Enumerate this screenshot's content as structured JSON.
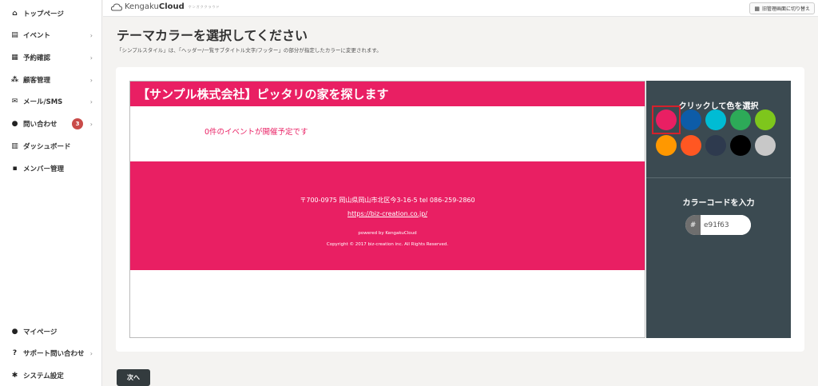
{
  "sidebar": {
    "top_items": [
      {
        "label": "トップページ",
        "icon": "home-icon",
        "chevron": ""
      },
      {
        "label": "イベント",
        "icon": "document-icon",
        "chevron": "›"
      },
      {
        "label": "予約確認",
        "icon": "calendar-icon",
        "chevron": "›"
      },
      {
        "label": "顧客管理",
        "icon": "users-icon",
        "chevron": "›"
      },
      {
        "label": "メール/SMS",
        "icon": "mail-icon",
        "chevron": "›"
      },
      {
        "label": "問い合わせ",
        "icon": "chat-icon",
        "chevron": "›",
        "badge": "3"
      },
      {
        "label": "ダッシュボード",
        "icon": "chart-icon",
        "chevron": ""
      },
      {
        "label": "メンバー管理",
        "icon": "grid-icon",
        "chevron": ""
      }
    ],
    "bottom_items": [
      {
        "label": "マイページ",
        "icon": "person-icon",
        "chevron": ""
      },
      {
        "label": "サポート問い合わせ",
        "icon": "help-icon",
        "chevron": "›"
      },
      {
        "label": "システム設定",
        "icon": "gear-icon",
        "chevron": ""
      }
    ]
  },
  "topbar": {
    "logo_main": "Kengaku",
    "logo_bold": "Cloud",
    "logo_sub": "ケンガククラウド",
    "switch_label": "旧管理画面に切り替え"
  },
  "main": {
    "title": "テーマカラーを選択してください",
    "description": "「シンプルスタイル」は、「ヘッダー/一覧サブタイトル文字/フッター」の部分が指定したカラーに変更されます。",
    "next_label": "次へ"
  },
  "preview": {
    "header_title": "【サンプル株式会社】ピッタリの家を探します",
    "event_text": "0件のイベントが開催予定です",
    "address": "〒700-0975 岡山県岡山市北区今3-16-5 tel 086-259-2860",
    "url": "https://biz-creation.co.jp/",
    "powered": "powered by KengakuCloud",
    "copyright": "Copyright © 2017 biz-creation inc. All Rights Reserved."
  },
  "picker": {
    "title": "クリックして色を選択",
    "swatches": [
      "#e91f63",
      "#0d5ca8",
      "#00bcd4",
      "#2daa58",
      "#7ec61c",
      "#ff9800",
      "#ff5722",
      "#2e3a4e",
      "#000000",
      "#c8c8c8"
    ],
    "selected_index": 0,
    "code_title": "カラーコードを入力",
    "hash": "#",
    "code_value": "e91f63"
  },
  "colors": {
    "theme": "#e91f63",
    "picker_bg": "#3b4a51",
    "selection_border": "#d4212b"
  }
}
